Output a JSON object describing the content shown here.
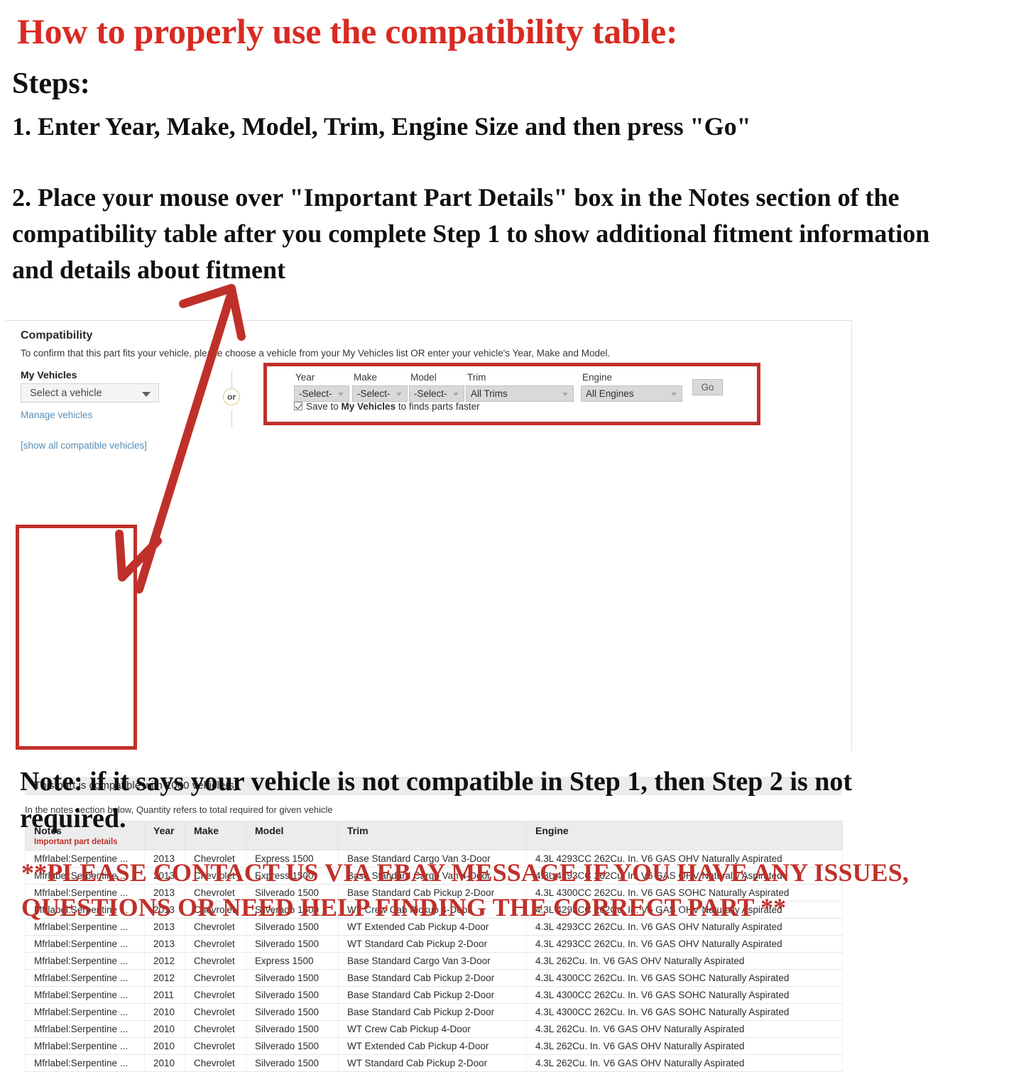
{
  "headline": "How to properly use the compatibility table:",
  "steps_label": "Steps:",
  "step_1": "1. Enter Year, Make, Model, Trim, Engine Size and then press \"Go\"",
  "step_2": "2. Place your mouse over \"Important Part Details\" box in the Notes section of the compatibility table after you complete Step 1 to show additional fitment information and details about fitment",
  "note_text": "Note: if it says your vehicle is not compatible in Step 1, then Step 2 is not required.",
  "contact_text": "**PLEASE CONTACT US VIA EBAY MESSAGE IF YOU HAVE ANY ISSUES, QUESTIONS OR NEED HELP FINDING THE CORRECT PART **",
  "colors": {
    "headline_red": "#D82A22",
    "box_red": "#C0302A",
    "link_blue": "#5a8fb5",
    "banner_grey": "#ececec",
    "or_gold": "#d7c98a"
  },
  "panel": {
    "title": "Compatibility",
    "subtitle": "To confirm that this part fits your vehicle, please choose a vehicle from your My Vehicles list OR enter your vehicle's Year, Make and Model.",
    "my_vehicles_label": "My Vehicles",
    "vehicle_select_value": "Select a vehicle",
    "manage_vehicles_link": "Manage vehicles",
    "show_all_link": "[show all compatible vehicles]",
    "or_label": "or",
    "fields": [
      {
        "label": "Year",
        "value": "-Select-"
      },
      {
        "label": "Make",
        "value": "-Select-"
      },
      {
        "label": "Model",
        "value": "-Select-"
      },
      {
        "label": "Trim",
        "value": "All Trims"
      },
      {
        "label": "Engine",
        "value": "All Engines"
      }
    ],
    "go_label": "Go",
    "save_prefix": "Save to ",
    "save_bold": "My Vehicles",
    "save_suffix": " to finds parts faster",
    "save_checked": true,
    "compat_banner": "This part is compatible with 1000 vehicle(s).",
    "notes_hint": "In the notes section below, Quantity refers to total required for given vehicle"
  },
  "table": {
    "headers": {
      "notes": "Notes",
      "notes_sub": "Important part details",
      "year": "Year",
      "make": "Make",
      "model": "Model",
      "trim": "Trim",
      "engine": "Engine"
    },
    "rows": [
      {
        "notes": "Mfrlabel:Serpentine ...",
        "year": "2013",
        "make": "Chevrolet",
        "model": "Express 1500",
        "trim": "Base Standard Cargo Van 3-Door",
        "engine": "4.3L 4293CC 262Cu. In. V6 GAS OHV Naturally Aspirated"
      },
      {
        "notes": "Mfrlabel:Serpentine ...",
        "year": "2013",
        "make": "Chevrolet",
        "model": "Express 1500",
        "trim": "Base Standard Cargo Van 4-Door",
        "engine": "4.3L 4293CC 262Cu. In. V6 GAS OHV Naturally Aspirated"
      },
      {
        "notes": "Mfrlabel:Serpentine ...",
        "year": "2013",
        "make": "Chevrolet",
        "model": "Silverado 1500",
        "trim": "Base Standard Cab Pickup 2-Door",
        "engine": "4.3L 4300CC 262Cu. In. V6 GAS SOHC Naturally Aspirated"
      },
      {
        "notes": "Mfrlabel:Serpentine ...",
        "year": "2013",
        "make": "Chevrolet",
        "model": "Silverado 1500",
        "trim": "WT Crew Cab Pickup 4-Door",
        "engine": "4.3L 4293CC 262Cu. In. V6 GAS OHV Naturally Aspirated"
      },
      {
        "notes": "Mfrlabel:Serpentine ...",
        "year": "2013",
        "make": "Chevrolet",
        "model": "Silverado 1500",
        "trim": "WT Extended Cab Pickup 4-Door",
        "engine": "4.3L 4293CC 262Cu. In. V6 GAS OHV Naturally Aspirated"
      },
      {
        "notes": "Mfrlabel:Serpentine ...",
        "year": "2013",
        "make": "Chevrolet",
        "model": "Silverado 1500",
        "trim": "WT Standard Cab Pickup 2-Door",
        "engine": "4.3L 4293CC 262Cu. In. V6 GAS OHV Naturally Aspirated"
      },
      {
        "notes": "Mfrlabel:Serpentine ...",
        "year": "2012",
        "make": "Chevrolet",
        "model": "Express 1500",
        "trim": "Base Standard Cargo Van 3-Door",
        "engine": "4.3L 262Cu. In. V6 GAS OHV Naturally Aspirated"
      },
      {
        "notes": "Mfrlabel:Serpentine ...",
        "year": "2012",
        "make": "Chevrolet",
        "model": "Silverado 1500",
        "trim": "Base Standard Cab Pickup 2-Door",
        "engine": "4.3L 4300CC 262Cu. In. V6 GAS SOHC Naturally Aspirated"
      },
      {
        "notes": "Mfrlabel:Serpentine ...",
        "year": "2011",
        "make": "Chevrolet",
        "model": "Silverado 1500",
        "trim": "Base Standard Cab Pickup 2-Door",
        "engine": "4.3L 4300CC 262Cu. In. V6 GAS SOHC Naturally Aspirated"
      },
      {
        "notes": "Mfrlabel:Serpentine ...",
        "year": "2010",
        "make": "Chevrolet",
        "model": "Silverado 1500",
        "trim": "Base Standard Cab Pickup 2-Door",
        "engine": "4.3L 4300CC 262Cu. In. V6 GAS SOHC Naturally Aspirated"
      },
      {
        "notes": "Mfrlabel:Serpentine ...",
        "year": "2010",
        "make": "Chevrolet",
        "model": "Silverado 1500",
        "trim": "WT Crew Cab Pickup 4-Door",
        "engine": "4.3L 262Cu. In. V6 GAS OHV Naturally Aspirated"
      },
      {
        "notes": "Mfrlabel:Serpentine ...",
        "year": "2010",
        "make": "Chevrolet",
        "model": "Silverado 1500",
        "trim": "WT Extended Cab Pickup 4-Door",
        "engine": "4.3L 262Cu. In. V6 GAS OHV Naturally Aspirated"
      },
      {
        "notes": "Mfrlabel:Serpentine ...",
        "year": "2010",
        "make": "Chevrolet",
        "model": "Silverado 1500",
        "trim": "WT Standard Cab Pickup 2-Door",
        "engine": "4.3L 262Cu. In. V6 GAS OHV Naturally Aspirated"
      }
    ]
  },
  "annotations": {
    "arrow_icon": "red-arrow-up-right",
    "form_highlight_icon": "red-rectangle-highlight",
    "notes_highlight_icon": "red-rectangle-highlight"
  }
}
